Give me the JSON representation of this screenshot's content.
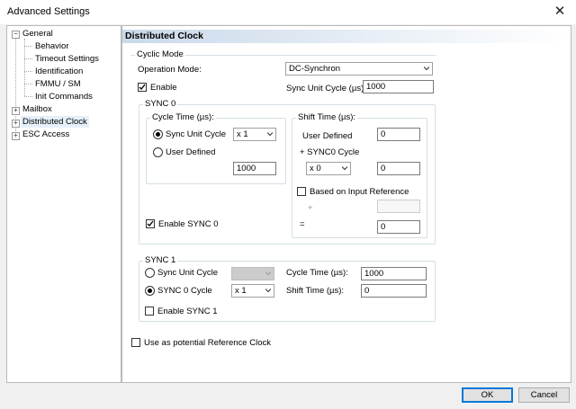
{
  "window": {
    "title": "Advanced Settings"
  },
  "tree": {
    "general": "General",
    "behavior": "Behavior",
    "timeout_settings": "Timeout Settings",
    "identification": "Identification",
    "fmmu_sm": "FMMU / SM",
    "init_commands": "Init Commands",
    "mailbox": "Mailbox",
    "distributed_clock": "Distributed Clock",
    "esc_access": "ESC Access",
    "collapse_symbol": "−",
    "expand_symbol": "+"
  },
  "panel": {
    "title": "Distributed Clock"
  },
  "cyclic_mode": {
    "label": "Cyclic Mode",
    "operation_mode_label": "Operation Mode:",
    "operation_mode_value": "DC-Synchron",
    "enable_label": "Enable",
    "enable_checked": true,
    "sync_unit_cycle_label": "Sync Unit Cycle (µs):",
    "sync_unit_cycle_value": "1000"
  },
  "sync0": {
    "label": "SYNC 0",
    "cycle_time_label": "Cycle Time (µs):",
    "sync_unit_cycle_label": "Sync Unit Cycle",
    "multiplier_value": "x 1",
    "user_defined_label": "User Defined",
    "cycle_time_value": "1000",
    "shift_time_label": "Shift Time (µs):",
    "shift_user_defined_label": "User Defined",
    "shift_user_defined_value": "0",
    "plus_sync0_cycle_label": "+ SYNC0 Cycle",
    "sync0_cycle_multiplier": "x 0",
    "sync0_cycle_value": "0",
    "based_on_input_label": "Based on Input Reference",
    "plus_sign": "+",
    "input_ref_value": "",
    "equals_sign": "=",
    "result_value": "0",
    "enable_label": "Enable SYNC 0",
    "enable_checked": true
  },
  "sync1": {
    "label": "SYNC 1",
    "sync_unit_cycle_label": "Sync Unit Cycle",
    "sync0_cycle_label": "SYNC 0 Cycle",
    "multiplier_value": "x 1",
    "cycle_time_label": "Cycle Time (µs):",
    "cycle_time_value": "1000",
    "shift_time_label": "Shift Time (µs):",
    "shift_time_value": "0",
    "enable_label": "Enable SYNC 1",
    "enable_checked": false
  },
  "reference_clock": {
    "label": "Use as potential Reference Clock",
    "checked": false
  },
  "buttons": {
    "ok": "OK",
    "cancel": "Cancel"
  },
  "icons": {
    "close": "close-icon",
    "dropdown": "chevron-down-icon",
    "check": "check-icon"
  },
  "colors": {
    "accent": "#0078d7",
    "header_gradient_start": "#c9d9ea",
    "selection": "#e5f0fb"
  }
}
